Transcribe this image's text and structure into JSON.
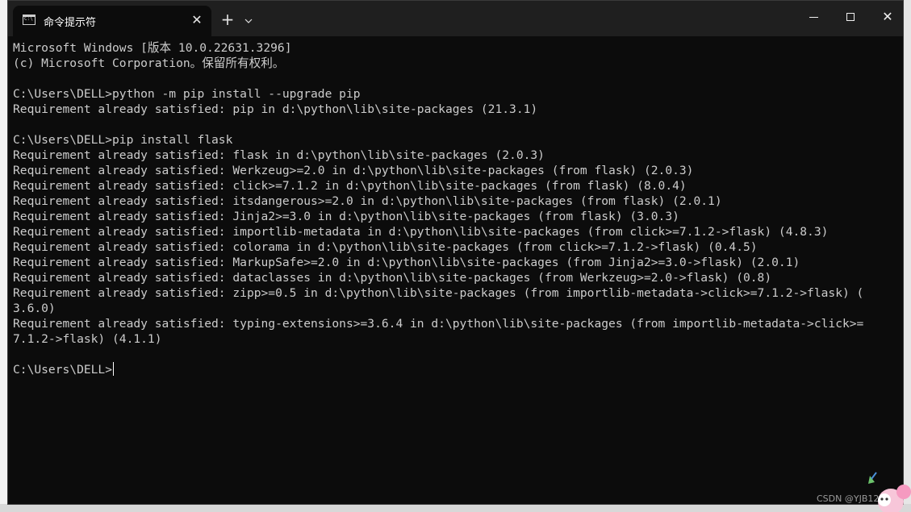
{
  "window": {
    "tab_title": "命令提示符",
    "tab_close_glyph": "✕",
    "new_tab_glyph": "+",
    "dropdown_glyph": "⌵",
    "close_glyph": "✕"
  },
  "console": {
    "lines": [
      "Microsoft Windows [版本 10.0.22631.3296]",
      "(c) Microsoft Corporation。保留所有权利。",
      "",
      "C:\\Users\\DELL>python -m pip install --upgrade pip",
      "Requirement already satisfied: pip in d:\\python\\lib\\site-packages (21.3.1)",
      "",
      "C:\\Users\\DELL>pip install flask",
      "Requirement already satisfied: flask in d:\\python\\lib\\site-packages (2.0.3)",
      "Requirement already satisfied: Werkzeug>=2.0 in d:\\python\\lib\\site-packages (from flask) (2.0.3)",
      "Requirement already satisfied: click>=7.1.2 in d:\\python\\lib\\site-packages (from flask) (8.0.4)",
      "Requirement already satisfied: itsdangerous>=2.0 in d:\\python\\lib\\site-packages (from flask) (2.0.1)",
      "Requirement already satisfied: Jinja2>=3.0 in d:\\python\\lib\\site-packages (from flask) (3.0.3)",
      "Requirement already satisfied: importlib-metadata in d:\\python\\lib\\site-packages (from click>=7.1.2->flask) (4.8.3)",
      "Requirement already satisfied: colorama in d:\\python\\lib\\site-packages (from click>=7.1.2->flask) (0.4.5)",
      "Requirement already satisfied: MarkupSafe>=2.0 in d:\\python\\lib\\site-packages (from Jinja2>=3.0->flask) (2.0.1)",
      "Requirement already satisfied: dataclasses in d:\\python\\lib\\site-packages (from Werkzeug>=2.0->flask) (0.8)",
      "Requirement already satisfied: zipp>=0.5 in d:\\python\\lib\\site-packages (from importlib-metadata->click>=7.1.2->flask) (",
      "3.6.0)",
      "Requirement already satisfied: typing-extensions>=3.6.4 in d:\\python\\lib\\site-packages (from importlib-metadata->click>=",
      "7.1.2->flask) (4.1.1)",
      ""
    ],
    "prompt": "C:\\Users\\DELL>"
  },
  "watermark": {
    "text": "CSDN @YJB120"
  },
  "colors": {
    "console_bg": "#0c0c0c",
    "console_text": "#cccccc",
    "titlebar_bg": "#1f1f1f"
  },
  "icons": {
    "tab_icon": "terminal-icon",
    "close": "close-icon",
    "add": "plus-icon",
    "dropdown": "chevron-down-icon",
    "minimize": "minimize-icon",
    "maximize": "maximize-icon"
  }
}
